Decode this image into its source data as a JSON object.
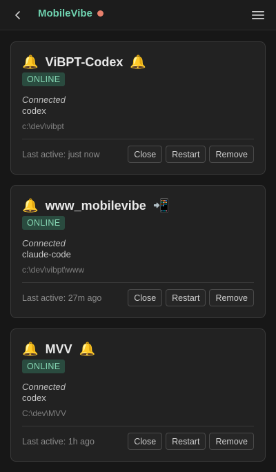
{
  "header": {
    "title": "MobileVibe",
    "status_color": "#e8806c",
    "accent_color": "#6fd3b0"
  },
  "sessions": [
    {
      "name": "ViBPT-Codex",
      "prefix_emoji": "🔔",
      "suffix_emoji": "🔔",
      "status": "ONLINE",
      "connection_label": "Connected",
      "agent": "codex",
      "path": "c:\\dev\\vibpt",
      "last_active": "Last active: just now",
      "buttons": {
        "close": "Close",
        "restart": "Restart",
        "remove": "Remove"
      }
    },
    {
      "name": "www_mobilevibe",
      "prefix_emoji": "🔔",
      "suffix_emoji": "📲",
      "status": "ONLINE",
      "connection_label": "Connected",
      "agent": "claude-code",
      "path": "c:\\dev\\vibpt\\www",
      "last_active": "Last active: 27m ago",
      "buttons": {
        "close": "Close",
        "restart": "Restart",
        "remove": "Remove"
      }
    },
    {
      "name": "MVV",
      "prefix_emoji": "🔔",
      "suffix_emoji": "🔔",
      "status": "ONLINE",
      "connection_label": "Connected",
      "agent": "codex",
      "path": "C:\\dev\\MVV",
      "last_active": "Last active: 1h ago",
      "buttons": {
        "close": "Close",
        "restart": "Restart",
        "remove": "Remove"
      }
    }
  ],
  "icons": {
    "back": "chevron-left-icon",
    "menu": "hamburger-menu-icon",
    "notify": "bell-icon",
    "device": "mobile-phone-arrow-icon"
  }
}
